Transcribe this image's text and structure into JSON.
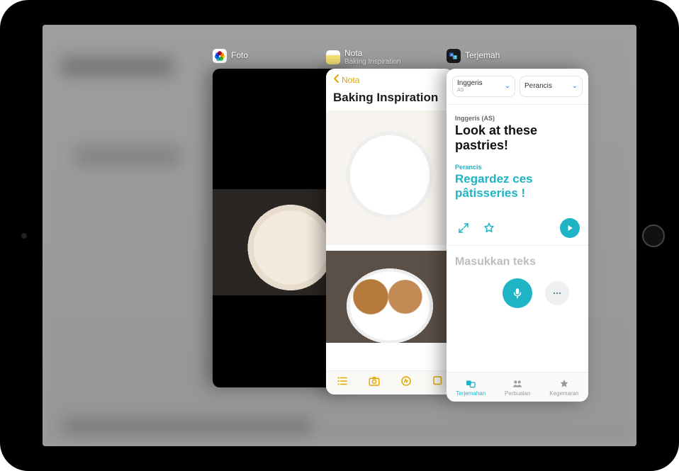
{
  "apps": {
    "photos": {
      "title": "Foto"
    },
    "notes": {
      "title": "Nota",
      "subtitle": "Baking Inspiration"
    },
    "translate": {
      "title": "Terjemah"
    }
  },
  "notes_card": {
    "back_label": "Nota",
    "note_title": "Baking Inspiration"
  },
  "translate_card": {
    "lang_from": "Inggeris",
    "lang_from_region": "AS",
    "lang_to": "Perancis",
    "label_from": "Inggeris (AS)",
    "text_from": "Look at these pastries!",
    "label_to": "Perancis",
    "text_to": "Regardez ces pâtisseries !",
    "input_placeholder": "Masukkan teks",
    "tabs": {
      "translate": "Terjemahan",
      "conversation": "Perbualan",
      "favorites": "Kegemaran"
    }
  },
  "colors": {
    "accent_teal": "#1fb3c6",
    "accent_yellow": "#e0a800",
    "ios_blue": "#0b84ff"
  }
}
